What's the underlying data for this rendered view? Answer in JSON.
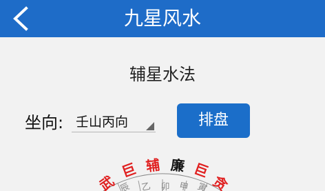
{
  "header": {
    "back_icon": "chevron-left-icon",
    "title": "九星风水"
  },
  "subtitle": "辅星水法",
  "form": {
    "facing_label": "坐向:",
    "facing_value": "壬山丙向",
    "submit_label": "排盘"
  },
  "dial": {
    "labels": [
      {
        "text": "武",
        "color": "#e02020"
      },
      {
        "text": "巨",
        "color": "#e02020"
      },
      {
        "text": "辅",
        "color": "#e02020"
      },
      {
        "text": "廉",
        "color": "#111111"
      },
      {
        "text": "巨",
        "color": "#e02020"
      },
      {
        "text": "贪",
        "color": "#e02020"
      }
    ],
    "inner_texts": [
      "辰",
      "乙",
      "卯",
      "甲",
      "寅"
    ]
  },
  "colors": {
    "header_bg": "#1e6cc8",
    "button_bg": "#1b6ec9",
    "accent_red": "#e02020"
  }
}
